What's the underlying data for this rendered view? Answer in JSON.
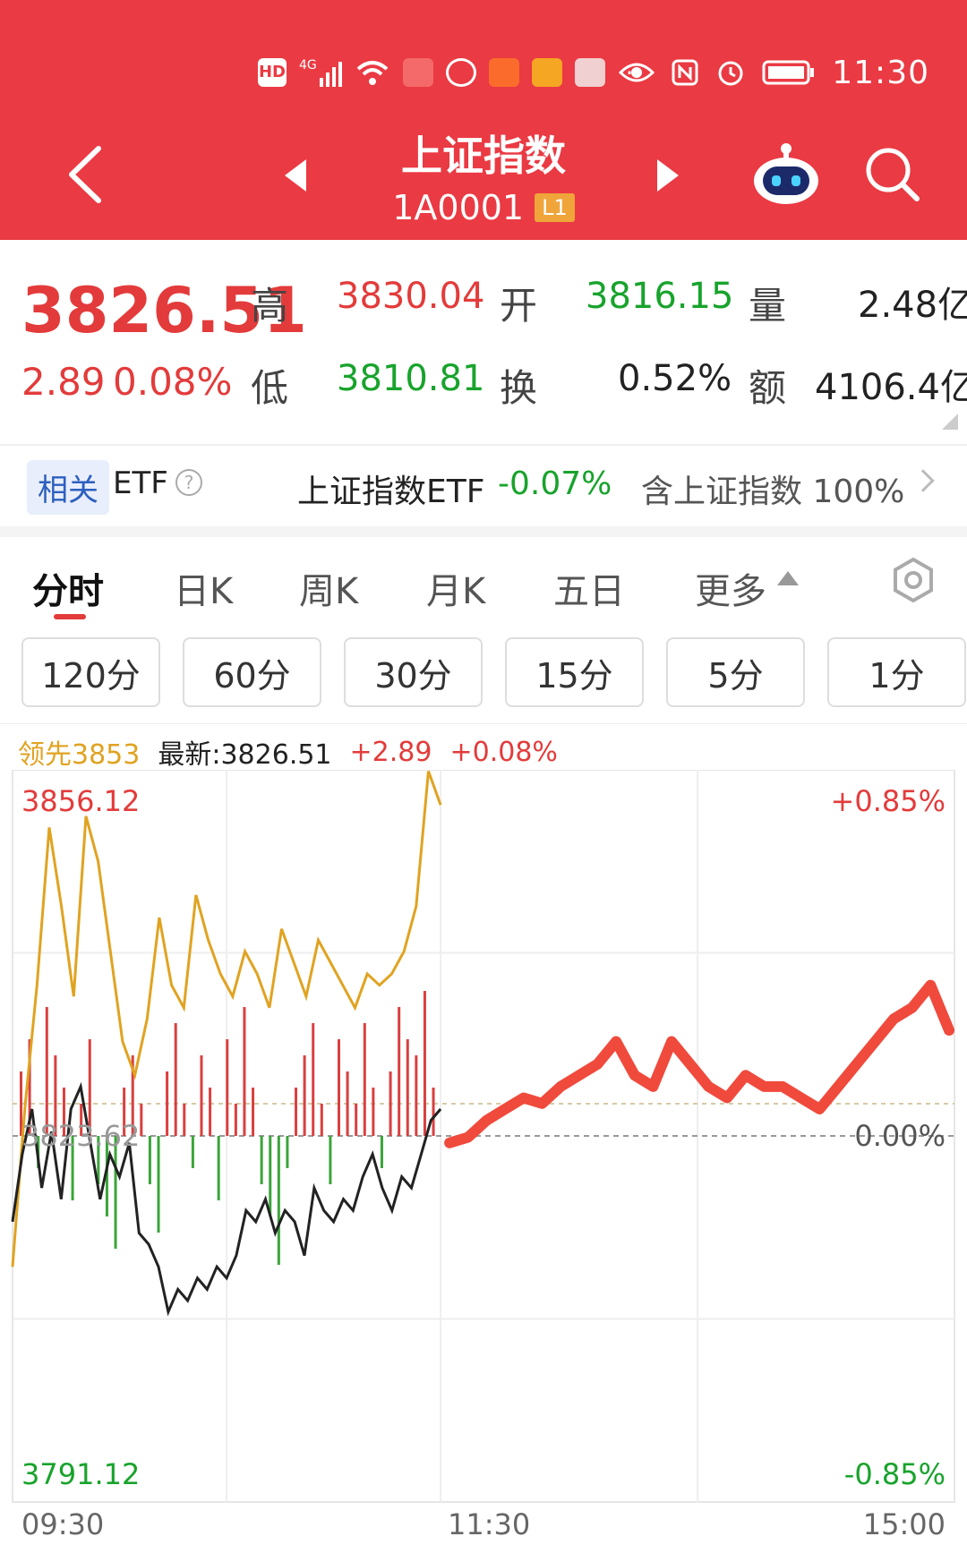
{
  "status_bar": {
    "time": "11:30",
    "network": "4G",
    "badge": "HD"
  },
  "header": {
    "title": "上证指数",
    "code": "1A0001",
    "level_badge": "L1"
  },
  "quote": {
    "price": "3826.51",
    "change": "2.89",
    "change_pct": "0.08%",
    "high_label": "高",
    "high": "3830.04",
    "low_label": "低",
    "low": "3810.81",
    "open_label": "开",
    "open": "3816.15",
    "turnover_label": "换",
    "turnover": "0.52%",
    "volume_label": "量",
    "volume": "2.48亿",
    "amount_label": "额",
    "amount": "4106.4亿"
  },
  "etf": {
    "tag": "相关",
    "label": "ETF",
    "help": "?",
    "name": "上证指数ETF",
    "change": "-0.07%",
    "contains": "含上证指数 100%"
  },
  "tabs": [
    "分时",
    "日K",
    "周K",
    "月K",
    "五日",
    "更多"
  ],
  "periods": [
    "120分",
    "60分",
    "30分",
    "15分",
    "5分",
    "1分"
  ],
  "chart_info": {
    "lead": "领先3853",
    "latest": "最新:3826.51",
    "change": "+2.89",
    "change_pct": "+0.08%"
  },
  "chart_data": {
    "type": "line",
    "ylim": [
      3791.12,
      3856.12
    ],
    "base": 3823.62,
    "y_top_label": "3856.12",
    "y_bottom_label": "3791.12",
    "y_base_label": "3823.62",
    "pct_top": "+0.85%",
    "pct_mid": "0.00%",
    "pct_bottom": "-0.85%",
    "x_ticks": [
      "09:30",
      "11:30",
      "15:00"
    ],
    "series": [
      {
        "color": "#222222",
        "values": [
          3816,
          3822,
          3826,
          3819,
          3824,
          3818,
          3826,
          3828,
          3823,
          3818,
          3822,
          3820,
          3823,
          3815,
          3814,
          3812,
          3808,
          3810,
          3809,
          3811,
          3810,
          3812,
          3811,
          3813,
          3817,
          3816,
          3818,
          3815,
          3817,
          3816,
          3813,
          3819,
          3817,
          3816,
          3818,
          3817,
          3820,
          3822,
          3819,
          3817,
          3820,
          3819,
          3822,
          3825,
          3826
        ]
      },
      {
        "color": "#e0a321",
        "values": [
          3812,
          3826,
          3837,
          3851,
          3844,
          3836,
          3852,
          3848,
          3840,
          3832,
          3829,
          3834,
          3843,
          3837,
          3835,
          3845,
          3841,
          3838,
          3836,
          3840,
          3838,
          3835,
          3842,
          3839,
          3836,
          3841,
          3839,
          3837,
          3835,
          3838,
          3837,
          3838,
          3840,
          3844,
          3856,
          3853
        ]
      },
      {
        "color": "#f04a3c",
        "values": [
          3823,
          3823.5,
          3825,
          3826,
          3827,
          3826.5,
          3828,
          3829,
          3830,
          3832,
          3829,
          3828,
          3832,
          3830,
          3828,
          3827,
          3829,
          3828,
          3828,
          3827,
          3826,
          3828,
          3830,
          3832,
          3834,
          3835,
          3837,
          3833
        ]
      }
    ],
    "volume_bars": [
      4,
      6,
      -2,
      8,
      5,
      3,
      -4,
      2,
      6,
      -3,
      -5,
      -7,
      3,
      5,
      2,
      -3,
      -6,
      4,
      7,
      2,
      -2,
      5,
      3,
      -4,
      6,
      2,
      8,
      3,
      -3,
      -5,
      -8,
      -2,
      3,
      5,
      7,
      2,
      -3,
      6,
      4,
      2,
      7,
      3,
      -2,
      4,
      8,
      6,
      5,
      9,
      3
    ]
  }
}
